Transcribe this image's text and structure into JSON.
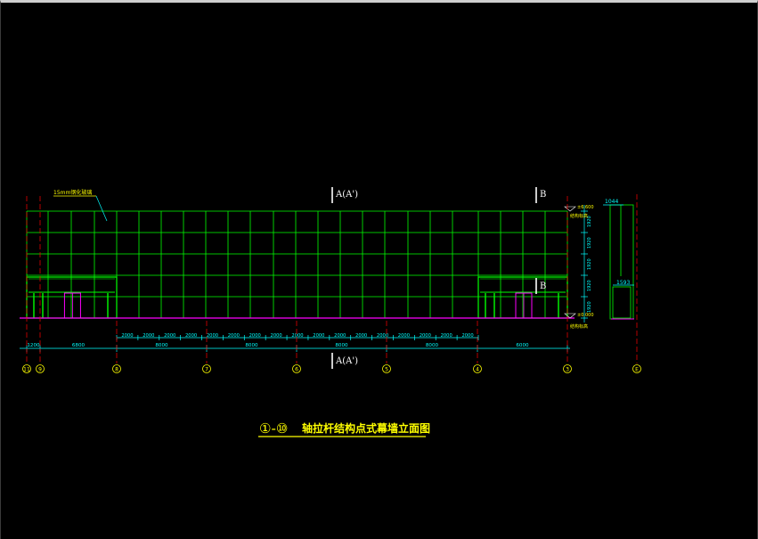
{
  "drawing": {
    "title_prefix": "①-⑩",
    "title_main": "轴拉杆结构点式幕墙立面图",
    "note_label": "15mm钢化玻璃",
    "section_A": "A(A')",
    "section_B": "B",
    "level_top": "±6.600",
    "level_top_sub": "结构标高",
    "level_bottom": "±0.000",
    "level_bottom_sub": "结构标高",
    "dim_side_top": "1044",
    "dim_side_bottom": "1593",
    "heights": [
      "1920",
      "1920",
      "1920",
      "1920",
      "1920"
    ],
    "small_dims": [
      "2000",
      "2000",
      "2000",
      "2000",
      "2000",
      "2000",
      "2000",
      "2000",
      "2000",
      "2000",
      "2000",
      "2000",
      "2000",
      "2000",
      "2000",
      "2000",
      "2000"
    ],
    "big_dims": [
      "1200",
      "6800",
      "8000",
      "8000",
      "8000",
      "8000",
      "6000"
    ],
    "axes": [
      "⑪",
      "⑨",
      "⑧",
      "⑦",
      "⑥",
      "⑤",
      "④",
      "③",
      "E"
    ]
  },
  "colors": {
    "grid": "#00ff00",
    "dimension": "#00ffff",
    "text": "#ffff00",
    "axis": "#ff0000",
    "accent": "#ff00ff",
    "frame": "#ffffff"
  }
}
